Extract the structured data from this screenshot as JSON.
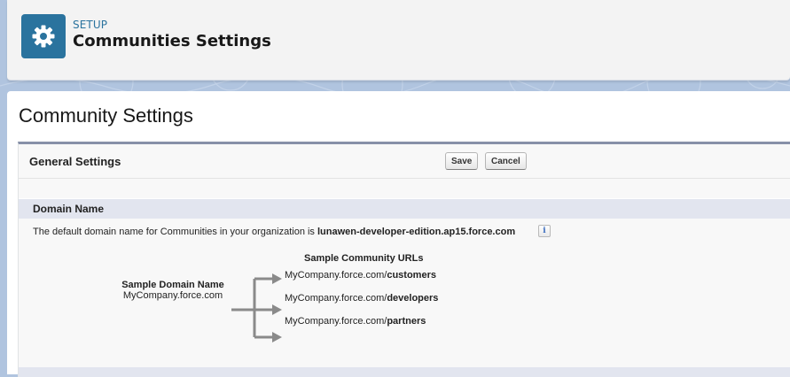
{
  "colors": {
    "background": "#b0c4df",
    "header_bg": "#f3f3f3",
    "icon_tile": "#2a739e",
    "eyebrow": "#2a739e",
    "section_bar": "#e2e5ef",
    "panel_border": "#8790a8"
  },
  "setup_header": {
    "icon": "gear-icon",
    "eyebrow": "SETUP",
    "title": "Communities Settings"
  },
  "page": {
    "title": "Community Settings"
  },
  "general_settings": {
    "title": "General Settings",
    "save_label": "Save",
    "cancel_label": "Cancel"
  },
  "domain_section": {
    "title": "Domain Name",
    "description_prefix": "The default domain name for Communities in your organization is ",
    "domain": "lunawen-developer-edition.ap15.force.com",
    "info_icon": "info-icon",
    "info_label": "i",
    "sample_urls_title": "Sample Community URLs",
    "sample_domain_label": "Sample Domain Name",
    "sample_domain_value": "MyCompany.force.com",
    "sample_urls": [
      {
        "base": "MyCompany.force.com/",
        "suffix": "customers"
      },
      {
        "base": "MyCompany.force.com/",
        "suffix": "developers"
      },
      {
        "base": "MyCompany.force.com/",
        "suffix": "partners"
      }
    ]
  }
}
